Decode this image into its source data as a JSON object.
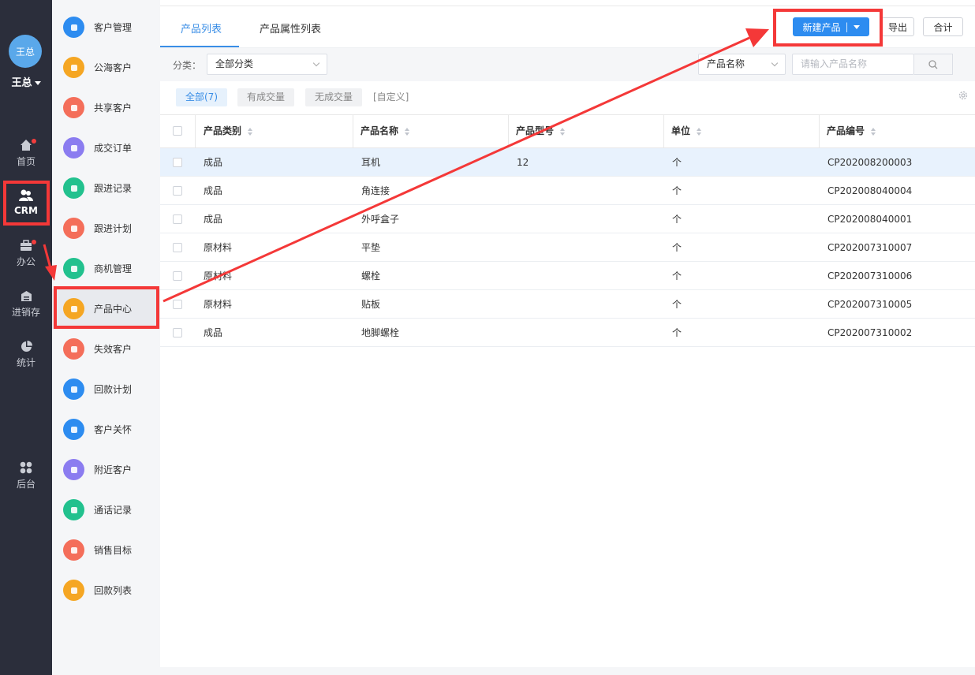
{
  "user": {
    "avatar_text": "王总",
    "name": "王总"
  },
  "nav": {
    "items": [
      {
        "label": "首页",
        "icon": "home-icon",
        "badge": true
      },
      {
        "label": "CRM",
        "icon": "users-icon",
        "badge": false,
        "active": true
      },
      {
        "label": "办公",
        "icon": "briefcase-icon",
        "badge": true
      },
      {
        "label": "进销存",
        "icon": "warehouse-icon",
        "badge": false
      },
      {
        "label": "统计",
        "icon": "pie-chart-icon",
        "badge": false
      },
      {
        "label": "后台",
        "icon": "grid-icon",
        "badge": false
      }
    ]
  },
  "menu": {
    "items": [
      {
        "label": "客户管理",
        "color": "#2d8cf0"
      },
      {
        "label": "公海客户",
        "color": "#f5a623"
      },
      {
        "label": "共享客户",
        "color": "#f46e5a"
      },
      {
        "label": "成交订单",
        "color": "#8b7cf0"
      },
      {
        "label": "跟进记录",
        "color": "#22c18e"
      },
      {
        "label": "跟进计划",
        "color": "#f46e5a"
      },
      {
        "label": "商机管理",
        "color": "#22c18e"
      },
      {
        "label": "产品中心",
        "color": "#f5a623",
        "active": true
      },
      {
        "label": "失效客户",
        "color": "#f46e5a"
      },
      {
        "label": "回款计划",
        "color": "#2d8cf0"
      },
      {
        "label": "客户关怀",
        "color": "#2d8cf0"
      },
      {
        "label": "附近客户",
        "color": "#8b7cf0"
      },
      {
        "label": "通话记录",
        "color": "#22c18e"
      },
      {
        "label": "销售目标",
        "color": "#f46e5a"
      },
      {
        "label": "回款列表",
        "color": "#f5a623"
      }
    ]
  },
  "tabs": [
    {
      "label": "产品列表",
      "active": true
    },
    {
      "label": "产品属性列表",
      "active": false
    }
  ],
  "toolbar": {
    "new_label": "新建产品",
    "export_label": "导出",
    "total_label": "合计"
  },
  "filter": {
    "category_label": "分类：",
    "category_value": "全部分类",
    "field_value": "产品名称",
    "search_placeholder": "请输入产品名称"
  },
  "chips": {
    "all": "全部(7)",
    "deal": "有成交量",
    "nodeal": "无成交量",
    "custom": "[自定义]"
  },
  "table": {
    "columns": [
      "产品类别",
      "产品名称",
      "产品型号",
      "单位",
      "产品编号"
    ],
    "rows": [
      [
        "成品",
        "耳机",
        "12",
        "个",
        "CP202008200003"
      ],
      [
        "成品",
        "角连接",
        "",
        "个",
        "CP202008040004"
      ],
      [
        "成品",
        "外呼盒子",
        "",
        "个",
        "CP202008040001"
      ],
      [
        "原材料",
        "平垫",
        "",
        "个",
        "CP202007310007"
      ],
      [
        "原材料",
        "螺栓",
        "",
        "个",
        "CP202007310006"
      ],
      [
        "原材料",
        "贴板",
        "",
        "个",
        "CP202007310005"
      ],
      [
        "成品",
        "地脚螺栓",
        "",
        "个",
        "CP202007310002"
      ]
    ]
  },
  "colors": {
    "accent": "#2d8cf0",
    "annotation": "#f43838",
    "nav_bg": "#2b2e3b"
  }
}
